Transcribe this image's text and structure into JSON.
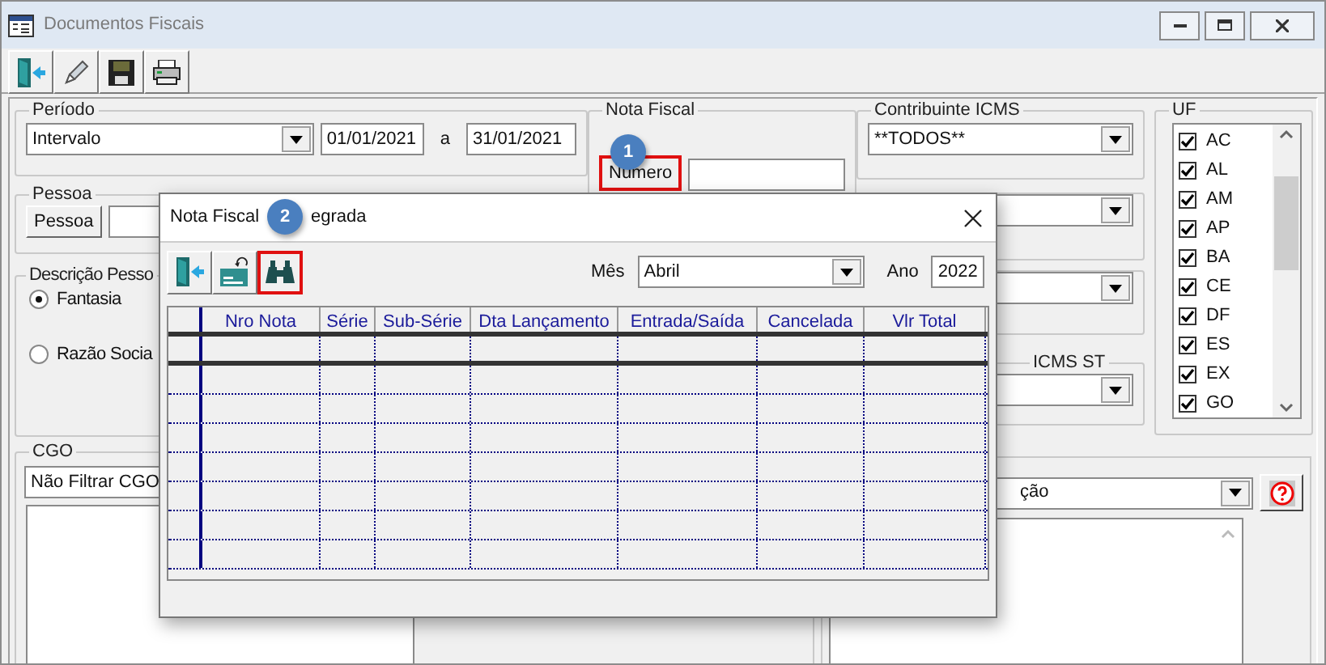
{
  "window": {
    "title": "Documentos Fiscais"
  },
  "periodo": {
    "label": "Período",
    "mode": "Intervalo",
    "from": "01/01/2021",
    "separator": "a",
    "to": "31/01/2021"
  },
  "pessoa": {
    "label": "Pessoa",
    "button": "Pessoa"
  },
  "descricao_pessoa": {
    "label": "Descrição Pesso",
    "options": [
      {
        "label": "Fantasia",
        "selected": true
      },
      {
        "label": "Razão Socia",
        "selected": false
      }
    ]
  },
  "nota_fiscal": {
    "label": "Nota Fiscal",
    "button": "Número",
    "highlighted": true,
    "step": "1"
  },
  "contribuinte_icms": {
    "label": "Contribuinte ICMS",
    "value": "**TODOS**"
  },
  "icms_st": {
    "label": "ICMS ST"
  },
  "uf": {
    "label": "UF",
    "items": [
      {
        "label": "AC",
        "checked": true
      },
      {
        "label": "AL",
        "checked": true
      },
      {
        "label": "AM",
        "checked": true
      },
      {
        "label": "AP",
        "checked": true
      },
      {
        "label": "BA",
        "checked": true
      },
      {
        "label": "CE",
        "checked": true
      },
      {
        "label": "DF",
        "checked": true
      },
      {
        "label": "ES",
        "checked": true
      },
      {
        "label": "EX",
        "checked": true
      },
      {
        "label": "GO",
        "checked": true
      }
    ]
  },
  "cgo": {
    "label": "CGO",
    "value": "Não Filtrar CGO"
  },
  "operacao": {
    "value": "ção"
  },
  "dialog": {
    "title_segments": [
      "Nota Fiscal",
      "egrada"
    ],
    "step": "2",
    "search_highlighted": true,
    "mes_label": "Mês",
    "mes": "Abril",
    "ano_label": "Ano",
    "ano": "2022",
    "columns": [
      "Nro Nota",
      "Série",
      "Sub-Série",
      "Dta Lançamento",
      "Entrada/Saída",
      "Cancelada",
      "Vlr Total"
    ]
  }
}
